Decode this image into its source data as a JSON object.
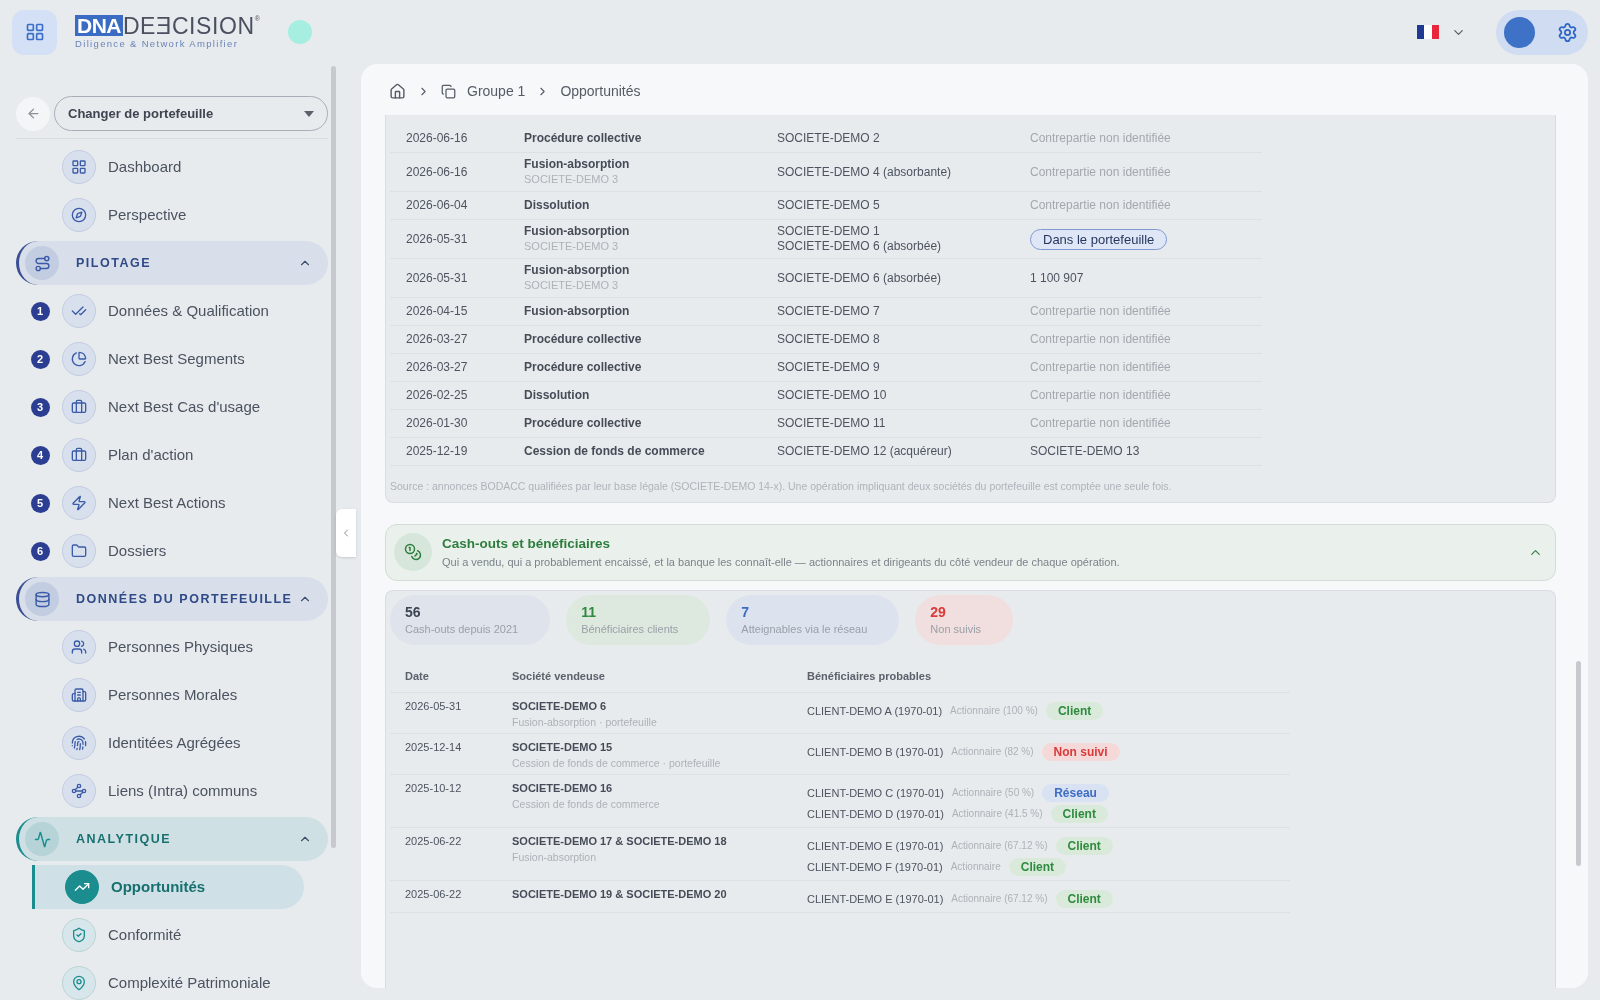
{
  "header": {
    "logo": {
      "mark": "DNA",
      "word": "DEƎCISION",
      "registered": "®",
      "tagline": "Diligence & Network Amplifier"
    }
  },
  "sidebar": {
    "portfolio_select": {
      "value": "Changer de portefeuille"
    },
    "groups": [
      {
        "kind": "plain",
        "items": [
          {
            "label": "Dashboard",
            "selected": false
          },
          {
            "label": "Perspective",
            "selected": false
          }
        ]
      },
      {
        "kind": "section",
        "title": "PILOTAGE",
        "expanded": true,
        "color": "#2f4a86",
        "items": [
          {
            "step": "1",
            "label": "Données & Qualification",
            "selected": false
          },
          {
            "step": "2",
            "label": "Next Best Segments",
            "selected": false
          },
          {
            "step": "3",
            "label": "Next Best Cas d'usage",
            "selected": false
          },
          {
            "step": "4",
            "label": "Plan d'action",
            "selected": false
          },
          {
            "step": "5",
            "label": "Next Best Actions",
            "selected": false
          },
          {
            "step": "6",
            "label": "Dossiers",
            "selected": false
          }
        ]
      },
      {
        "kind": "section",
        "title": "DONNÉES DU PORTEFEUILLE",
        "expanded": true,
        "color": "#2f4a86",
        "items": [
          {
            "label": "Personnes Physiques",
            "selected": false
          },
          {
            "label": "Personnes Morales",
            "selected": false
          },
          {
            "label": "Identitées Agrégées",
            "selected": false
          },
          {
            "label": "Liens (Intra) communs",
            "selected": false
          }
        ]
      },
      {
        "kind": "section",
        "title": "ANALYTIQUE",
        "expanded": true,
        "color": "#17706f",
        "items": [
          {
            "label": "Opportunités",
            "selected": true
          },
          {
            "label": "Conformité",
            "selected": false
          },
          {
            "label": "Complexité Patrimoniale",
            "selected": false
          }
        ]
      }
    ]
  },
  "breadcrumb": [
    "Groupe 1",
    "Opportunités"
  ],
  "operations": {
    "rows": [
      {
        "date": "2026-06-16",
        "type": "Procédure collective",
        "companies": [
          "SOCIETE-DEMO 2"
        ],
        "counterparty": {
          "kind": "unknown",
          "text": "Contrepartie non identifiée"
        }
      },
      {
        "date": "2026-06-16",
        "type": "Fusion-absorption",
        "subject": "SOCIETE-DEMO 3",
        "companies": [
          "SOCIETE-DEMO 4 (absorbante)"
        ],
        "counterparty": {
          "kind": "unknown",
          "text": "Contrepartie non identifiée"
        }
      },
      {
        "date": "2026-06-04",
        "type": "Dissolution",
        "companies": [
          "SOCIETE-DEMO 5"
        ],
        "counterparty": {
          "kind": "unknown",
          "text": "Contrepartie non identifiée"
        }
      },
      {
        "date": "2026-05-31",
        "type": "Fusion-absorption",
        "subject": "SOCIETE-DEMO 3",
        "companies": [
          "SOCIETE-DEMO 1",
          "SOCIETE-DEMO 6 (absorbée)"
        ],
        "counterparty": {
          "kind": "badge",
          "text": "Dans le portefeuille"
        }
      },
      {
        "date": "2026-05-31",
        "type": "Fusion-absorption",
        "subject": "SOCIETE-DEMO 3",
        "companies": [
          "SOCIETE-DEMO 6 (absorbée)"
        ],
        "counterparty": {
          "kind": "plain",
          "text": "1 100 907"
        }
      },
      {
        "date": "2026-04-15",
        "type": "Fusion-absorption",
        "companies": [
          "SOCIETE-DEMO 7"
        ],
        "counterparty": {
          "kind": "unknown",
          "text": "Contrepartie non identifiée"
        }
      },
      {
        "date": "2026-03-27",
        "type": "Procédure collective",
        "companies": [
          "SOCIETE-DEMO 8"
        ],
        "counterparty": {
          "kind": "unknown",
          "text": "Contrepartie non identifiée"
        }
      },
      {
        "date": "2026-03-27",
        "type": "Procédure collective",
        "companies": [
          "SOCIETE-DEMO 9"
        ],
        "counterparty": {
          "kind": "unknown",
          "text": "Contrepartie non identifiée"
        }
      },
      {
        "date": "2026-02-25",
        "type": "Dissolution",
        "companies": [
          "SOCIETE-DEMO 10"
        ],
        "counterparty": {
          "kind": "unknown",
          "text": "Contrepartie non identifiée"
        }
      },
      {
        "date": "2026-01-30",
        "type": "Procédure collective",
        "companies": [
          "SOCIETE-DEMO 11"
        ],
        "counterparty": {
          "kind": "unknown",
          "text": "Contrepartie non identifiée"
        }
      },
      {
        "date": "2025-12-19",
        "type": "Cession de fonds de commerce",
        "companies": [
          "SOCIETE-DEMO 12 (acquéreur)"
        ],
        "counterparty": {
          "kind": "plain",
          "text": "SOCIETE-DEMO 13"
        }
      }
    ],
    "footnote": "Source : annonces BODACC qualifiées par leur base légale (SOCIETE-DEMO 14-x). Une opération impliquant deux sociétés du portefeuille est comptée une seule fois."
  },
  "cashouts": {
    "title": "Cash-outs et bénéficiaires",
    "subtitle": "Qui a vendu, qui a probablement encaissé, et la banque les connaît-elle — actionnaires et dirigeants du côté vendeur de chaque opération.",
    "expanded": true,
    "stats": [
      {
        "value": "56",
        "label": "Cash-outs depuis 2021",
        "kind": "total"
      },
      {
        "value": "11",
        "label": "Bénéficiaires clients",
        "kind": "client"
      },
      {
        "value": "7",
        "label": "Atteignables via le réseau",
        "kind": "network"
      },
      {
        "value": "29",
        "label": "Non suivis",
        "kind": "untracked"
      }
    ],
    "columns": [
      "Date",
      "Société vendeuse",
      "Bénéficiaires probables"
    ],
    "rows": [
      {
        "date": "2026-05-31",
        "seller": "SOCIETE-DEMO 6",
        "detail": "Fusion-absorption · portefeuille",
        "beneficiaries": [
          {
            "name": "CLIENT-DEMO A (1970-01)",
            "role": "Actionnaire (100 %)",
            "status": {
              "kind": "client",
              "label": "Client"
            }
          }
        ]
      },
      {
        "date": "2025-12-14",
        "seller": "SOCIETE-DEMO 15",
        "detail": "Cession de fonds de commerce · portefeuille",
        "beneficiaries": [
          {
            "name": "CLIENT-DEMO B (1970-01)",
            "role": "Actionnaire (82 %)",
            "status": {
              "kind": "untracked",
              "label": "Non suivi"
            }
          }
        ]
      },
      {
        "date": "2025-10-12",
        "seller": "SOCIETE-DEMO 16",
        "detail": "Cession de fonds de commerce",
        "beneficiaries": [
          {
            "name": "CLIENT-DEMO C (1970-01)",
            "role": "Actionnaire (50 %)",
            "status": {
              "kind": "network",
              "label": "Réseau"
            }
          },
          {
            "name": "CLIENT-DEMO D (1970-01)",
            "role": "Actionnaire (41.5 %)",
            "status": {
              "kind": "client",
              "label": "Client"
            }
          }
        ]
      },
      {
        "date": "2025-06-22",
        "seller": "SOCIETE-DEMO 17 & SOCIETE-DEMO 18",
        "detail": "Fusion-absorption",
        "beneficiaries": [
          {
            "name": "CLIENT-DEMO E (1970-01)",
            "role": "Actionnaire (67.12 %)",
            "status": {
              "kind": "client",
              "label": "Client"
            }
          },
          {
            "name": "CLIENT-DEMO F (1970-01)",
            "role": "Actionnaire",
            "status": {
              "kind": "client",
              "label": "Client"
            }
          }
        ]
      },
      {
        "date": "2025-06-22",
        "seller": "SOCIETE-DEMO 19 & SOCIETE-DEMO 20",
        "beneficiaries": [
          {
            "name": "CLIENT-DEMO E (1970-01)",
            "role": "Actionnaire (67.12 %)",
            "status": {
              "kind": "client",
              "label": "Client"
            }
          }
        ]
      }
    ]
  }
}
